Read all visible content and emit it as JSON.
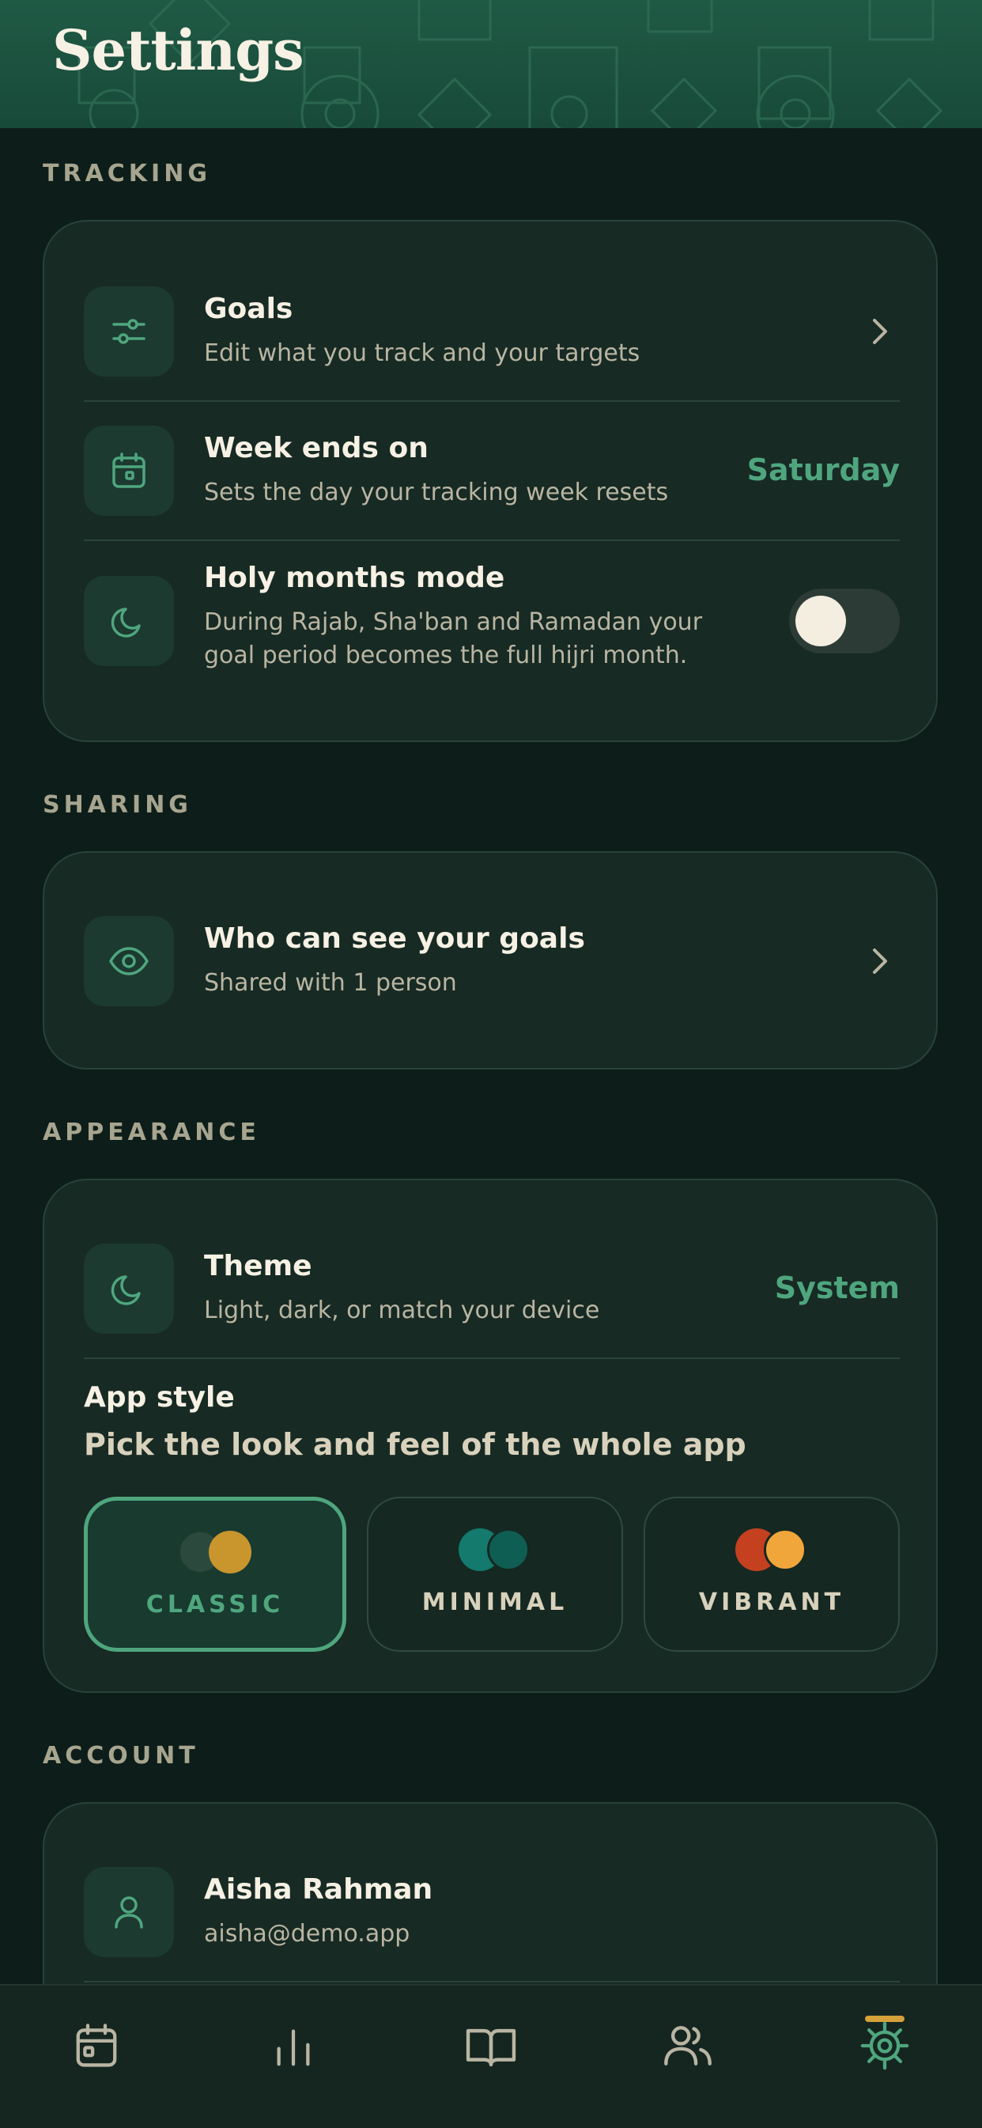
{
  "header": {
    "title": "Settings"
  },
  "sections": {
    "tracking": {
      "label": "TRACKING",
      "goals": {
        "title": "Goals",
        "subtitle": "Edit what you track and your targets"
      },
      "week_ends": {
        "title": "Week ends on",
        "subtitle": "Sets the day your tracking week resets",
        "value": "Saturday"
      },
      "holy_months": {
        "title": "Holy months mode",
        "subtitle_line1": "During Rajab, Sha'ban and Ramadan your",
        "subtitle_line2": "goal period becomes the full hijri month.",
        "enabled": false
      }
    },
    "sharing": {
      "label": "SHARING",
      "visibility": {
        "title": "Who can see your goals",
        "subtitle": "Shared with 1 person"
      }
    },
    "appearance": {
      "label": "APPEARANCE",
      "theme": {
        "title": "Theme",
        "subtitle": "Light, dark, or match your device",
        "value": "System"
      },
      "app_style": {
        "title": "App style",
        "subtitle": "Pick the look and feel of the whole app",
        "selected": "CLASSIC",
        "options": [
          {
            "label": "CLASSIC",
            "colors": [
              "#2b4a3d",
              "#c9962e"
            ]
          },
          {
            "label": "MINIMAL",
            "colors": [
              "#137a6d",
              "#0f5e54"
            ]
          },
          {
            "label": "VIBRANT",
            "colors": [
              "#c4401f",
              "#f0a63a"
            ]
          }
        ]
      }
    },
    "account": {
      "label": "ACCOUNT",
      "user": {
        "name": "Aisha Rahman",
        "email": "aisha@demo.app"
      }
    }
  },
  "tabbar": {
    "tabs": [
      "calendar-icon",
      "stats-icon",
      "book-icon",
      "people-icon",
      "settings-icon"
    ],
    "active": "settings-icon"
  },
  "colors": {
    "accent": "#4fa67e",
    "gold": "#d4a13a",
    "background": "#0d1d19",
    "card": "#172a24"
  }
}
